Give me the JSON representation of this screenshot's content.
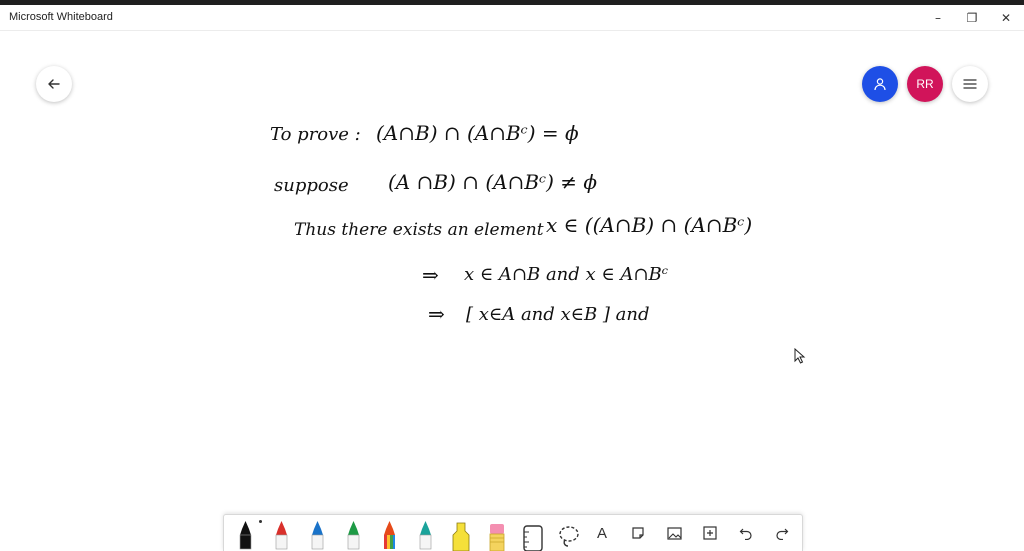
{
  "window": {
    "title": "Microsoft Whiteboard",
    "minimize_glyph": "–",
    "maximize_glyph": "❐",
    "close_glyph": "✕"
  },
  "header": {
    "back_icon": "arrow-left-icon",
    "share_icon": "person-icon",
    "avatar_initials": "RR",
    "menu_icon": "hamburger-icon"
  },
  "colors": {
    "share": "#1e4fe6",
    "avatar": "#d1145a",
    "ink": "#111111"
  },
  "whiteboard": {
    "lines": [
      {
        "label": "To prove :",
        "math": "(A∩B) ∩ (A∩Bᶜ) = ϕ"
      },
      {
        "label": "suppose",
        "math": "(A ∩B) ∩ (A∩Bᶜ) ≠ ϕ"
      },
      {
        "label": "Thus there exists an element",
        "math": "x ∈ ((A∩B) ∩ (A∩Bᶜ)"
      },
      {
        "label": "⇒",
        "math": "x ∈ A∩B  and  x ∈ A∩Bᶜ"
      },
      {
        "label": "⇒",
        "math": "[ x∈A  and x∈B ]  and"
      }
    ]
  },
  "toolbar": {
    "tools": [
      {
        "name": "black-pen",
        "color": "#111111"
      },
      {
        "name": "red-pen",
        "color": "#d9302b"
      },
      {
        "name": "blue-pen",
        "color": "#1a73c9"
      },
      {
        "name": "green-pen",
        "color": "#1e9a45"
      },
      {
        "name": "rainbow-pen",
        "color": "#e64a19"
      },
      {
        "name": "teal-pen",
        "color": "#1aa39b"
      },
      {
        "name": "yellow-highlighter",
        "color": "#f5e03a"
      },
      {
        "name": "eraser",
        "color": "#f48fb1"
      },
      {
        "name": "ruler-icon",
        "color": "#333333"
      },
      {
        "name": "lasso-icon",
        "color": "#333333"
      }
    ],
    "text_tool_glyph": "A",
    "extra_icons": [
      "sticky-note-icon",
      "image-icon",
      "insert-icon",
      "undo-icon",
      "redo-icon"
    ]
  }
}
